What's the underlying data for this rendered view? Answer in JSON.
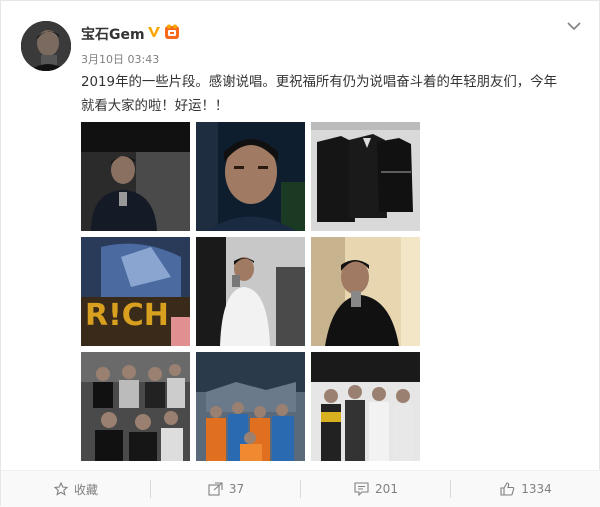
{
  "post": {
    "author": "宝石Gem",
    "timestamp": "3月10日 03:43",
    "text_line1": "2019年的一些片段。感谢说唱。更祝福所有仍为说唱奋斗着的年轻朋友们，今年",
    "text_line2": "就看大家的啦！好运！！"
  },
  "icons": {
    "verified": "verified-v-icon",
    "vip": "vip-badge-icon",
    "more": "chevron-down-icon",
    "favorite": "star-icon",
    "repost": "repost-icon",
    "comment": "comment-icon",
    "like": "thumbs-up-icon"
  },
  "photos": [
    "photo-1",
    "photo-2",
    "photo-3",
    "photo-4",
    "photo-5",
    "photo-6",
    "photo-7",
    "photo-8",
    "photo-9"
  ],
  "actions": {
    "favorite_label": "收藏",
    "repost_count": "37",
    "comment_count": "201",
    "like_count": "1334"
  },
  "colors": {
    "text": "#333333",
    "muted": "#808080",
    "verified": "#f7a600",
    "vip": "#f76a1b"
  }
}
